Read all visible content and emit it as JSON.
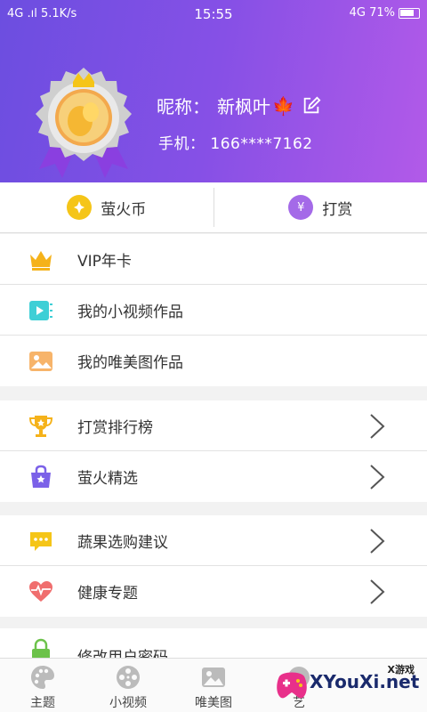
{
  "status_bar": {
    "left": "4G  .ıl  5.1K/s",
    "time": "15:55",
    "right": "4G  71%"
  },
  "profile": {
    "nickname_label": "昵称：",
    "nickname": "新枫叶",
    "nickname_emoji": "🍁",
    "phone_label": "手机：",
    "phone": "166****7162"
  },
  "coins": {
    "left_label": "萤火币",
    "right_label": "打赏"
  },
  "menu": {
    "group1": [
      "VIP年卡",
      "我的小视频作品",
      "我的唯美图作品"
    ],
    "group2": [
      "打赏排行榜",
      "萤火精选"
    ],
    "group3": [
      "蔬果选购建议",
      "健康专题"
    ],
    "group4": [
      "修改用户密码"
    ]
  },
  "tabs": [
    "主题",
    "小视频",
    "唯美图",
    "艺"
  ],
  "watermark": {
    "site": "XYouXi.net",
    "small": "X游戏"
  },
  "colors": {
    "header_start": "#6c4ee0",
    "header_end": "#b25ae8",
    "coin_yellow": "#f5c518",
    "tip_purple": "#a46ae8"
  }
}
